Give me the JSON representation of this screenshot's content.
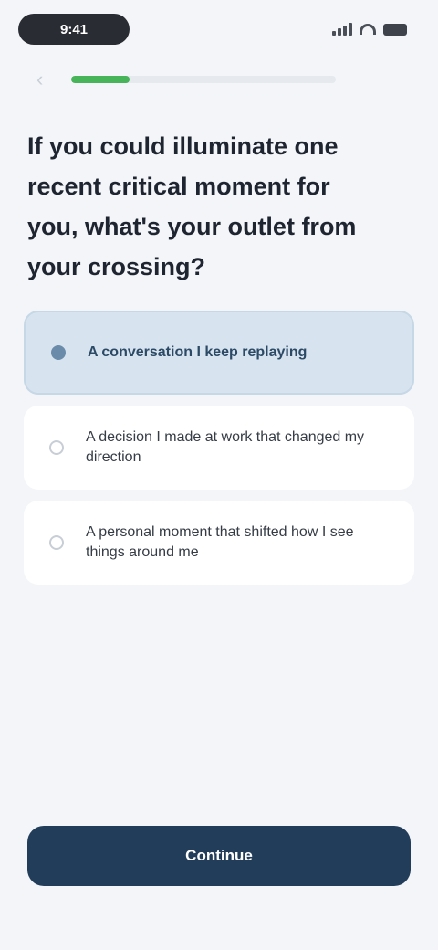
{
  "status_bar": {
    "time": "9:41"
  },
  "progress": {
    "value": 0.22,
    "color": "#47b45a"
  },
  "question": {
    "text": "If you could illuminate one recent critical moment for you, what's your outlet from your crossing?"
  },
  "options": [
    {
      "label": "A conversation I keep replaying",
      "selected": true
    },
    {
      "label": "A decision I made at work that changed my direction",
      "selected": false
    },
    {
      "label": "A personal moment that shifted how I see things around me",
      "selected": false
    }
  ],
  "cta": {
    "label": "Continue"
  },
  "colors": {
    "background": "#f3f5f8",
    "selected_bg": "#d7e4ef",
    "primary": "#223d5a"
  }
}
